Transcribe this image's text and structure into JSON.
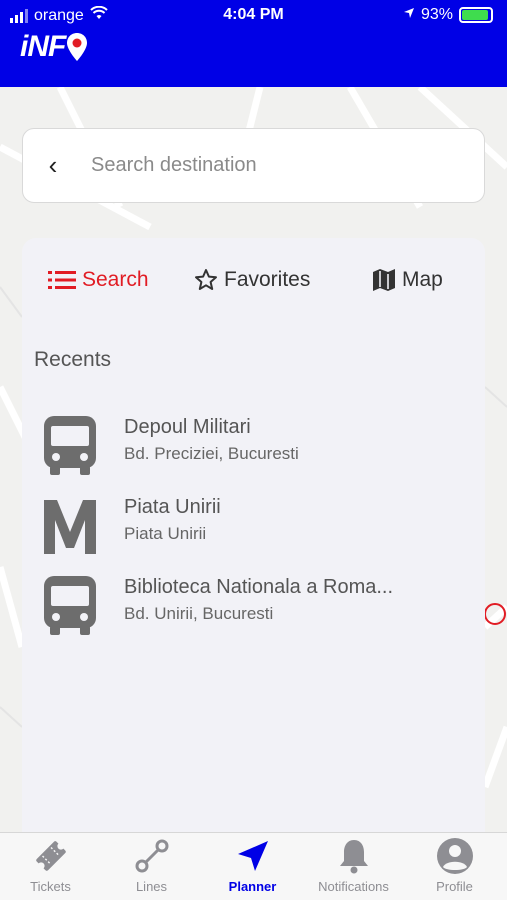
{
  "status_bar": {
    "carrier": "orange",
    "time": "4:04 PM",
    "battery": "93%",
    "battery_level": 0.93
  },
  "app": {
    "logo_text": "iNF"
  },
  "search": {
    "placeholder": "Search destination",
    "back_icon": "chevron-left-icon"
  },
  "tabs": [
    {
      "label": "Search",
      "icon": "list-icon",
      "active": true
    },
    {
      "label": "Favorites",
      "icon": "star-icon",
      "active": false
    },
    {
      "label": "Map",
      "icon": "map-icon",
      "active": false
    }
  ],
  "recents": {
    "title": "Recents",
    "items": [
      {
        "name": "Depoul Militari",
        "address": "Bd. Preciziei, Bucuresti",
        "icon": "bus-icon"
      },
      {
        "name": "Piata Unirii",
        "address": "Piata Unirii",
        "icon": "metro-icon"
      },
      {
        "name": "Biblioteca Nationala a Roma...",
        "address": "Bd. Unirii, Bucuresti",
        "icon": "bus-icon"
      }
    ]
  },
  "tabbar": [
    {
      "label": "Tickets",
      "icon": "ticket-icon",
      "active": false
    },
    {
      "label": "Lines",
      "icon": "route-icon",
      "active": false
    },
    {
      "label": "Planner",
      "icon": "navigation-arrow-icon",
      "active": true
    },
    {
      "label": "Notifications",
      "icon": "bell-icon",
      "active": false
    },
    {
      "label": "Profile",
      "icon": "user-icon",
      "active": false
    }
  ],
  "colors": {
    "brand": "#0000e6",
    "accent": "#e11c24",
    "icon_gray": "#6d6d6d"
  }
}
